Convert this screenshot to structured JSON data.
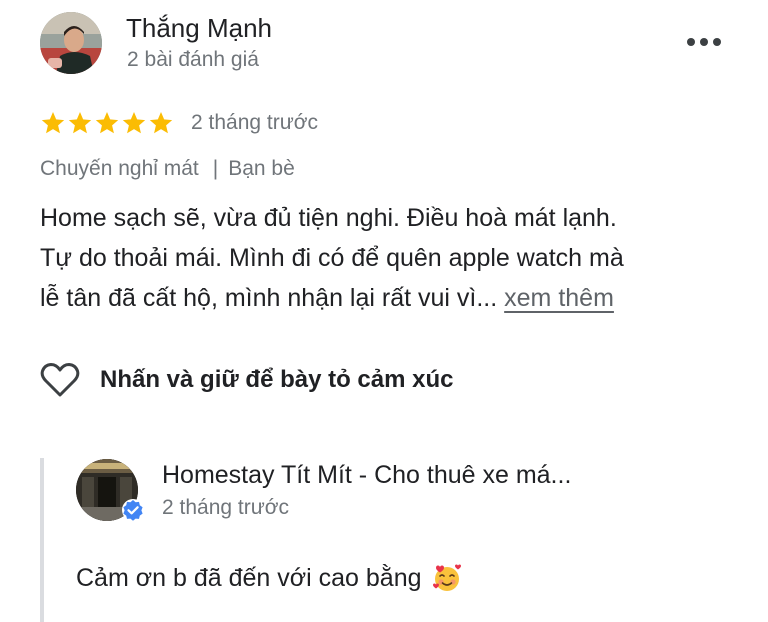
{
  "reviewer": {
    "name": "Thắng Mạnh",
    "meta": "2 bài đánh giá",
    "avatar_icon": "user-photo-avatar"
  },
  "menu": {
    "icon": "more-horizontal-icon"
  },
  "review": {
    "rating": 5,
    "rating_max": 5,
    "star_color": "#fbbc04",
    "date": "2 tháng trước",
    "trip_type": "Chuyến nghỉ mát",
    "separator": "|",
    "companions": "Bạn bè",
    "text_lines": [
      "Home sạch sẽ, vừa đủ tiện nghi. Điều hoà mát lạnh.",
      "Tự do thoải mái. Mình đi có để quên apple watch mà",
      "lễ tân đã cất hộ, mình nhận lại rất vui vì..."
    ],
    "see_more": "xem thêm"
  },
  "reaction": {
    "label": "Nhấn và giữ để bày tỏ cảm xúc",
    "icon": "heart-outline-icon"
  },
  "owner_response": {
    "name": "Homestay Tít Mít - Cho thuê xe má...",
    "date": "2 tháng trước",
    "text": "Cảm ơn b đã đến với cao bằng",
    "emoji": "smiling-face-with-hearts-icon",
    "badge_icon": "verified-badge-icon",
    "badge_color": "#4285f4"
  }
}
